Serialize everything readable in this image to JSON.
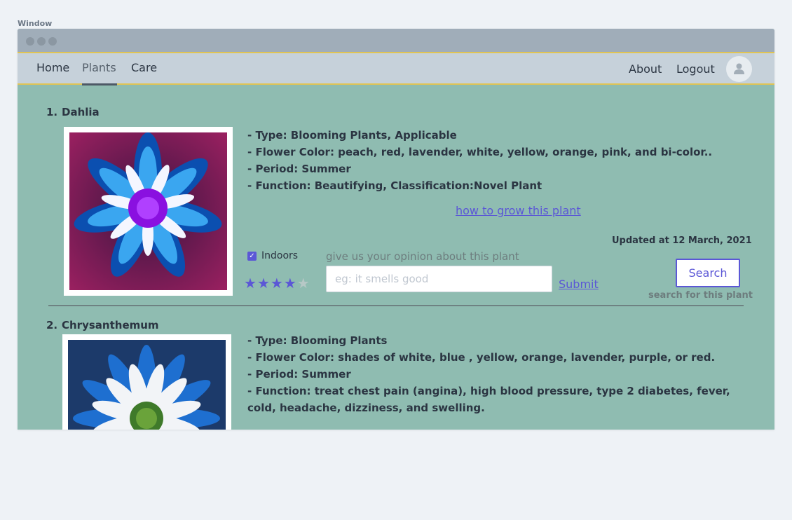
{
  "window": {
    "label": "Window"
  },
  "nav": {
    "left": [
      "Home",
      "Plants",
      "Care"
    ],
    "right": [
      "About",
      "Logout"
    ],
    "active": "Plants"
  },
  "plants": [
    {
      "number": "1.",
      "name": "Dahlia",
      "details": [
        "- Type: Blooming Plants, Applicable",
        "- Flower Color:  peach, red, lavender, white, yellow, orange, pink, and bi-color..",
        "- Period: Summer",
        "- Function: Beautifying, Classification:Novel Plant"
      ],
      "grow_link": "how to grow this plant",
      "updated": "Updated at 12 March, 2021",
      "indoors_label": "Indoors",
      "indoors_checked": true,
      "rating": 4,
      "rating_max": 5,
      "opinion_label": "give us your opinion about this plant",
      "opinion_placeholder": "eg: it smells good",
      "submit_label": "Submit",
      "search_label": "Search",
      "search_hint": "search for this plant"
    },
    {
      "number": "2.",
      "name": "Chrysanthemum",
      "details": [
        "- Type: Blooming Plants",
        "- Flower Color:   shades of white, blue , yellow, orange, lavender, purple, or red.",
        "- Period: Summer",
        "- Function: treat chest pain (angina), high blood pressure, type 2 diabetes, fever,",
        "cold, headache, dizziness, and swelling."
      ]
    }
  ],
  "colors": {
    "content_bg": "#8fbcb1",
    "accent": "#5b57d6",
    "nav_border": "#e0c454"
  },
  "icons": {
    "avatar": "user-icon",
    "checkbox": "check-icon",
    "star": "star-icon"
  }
}
